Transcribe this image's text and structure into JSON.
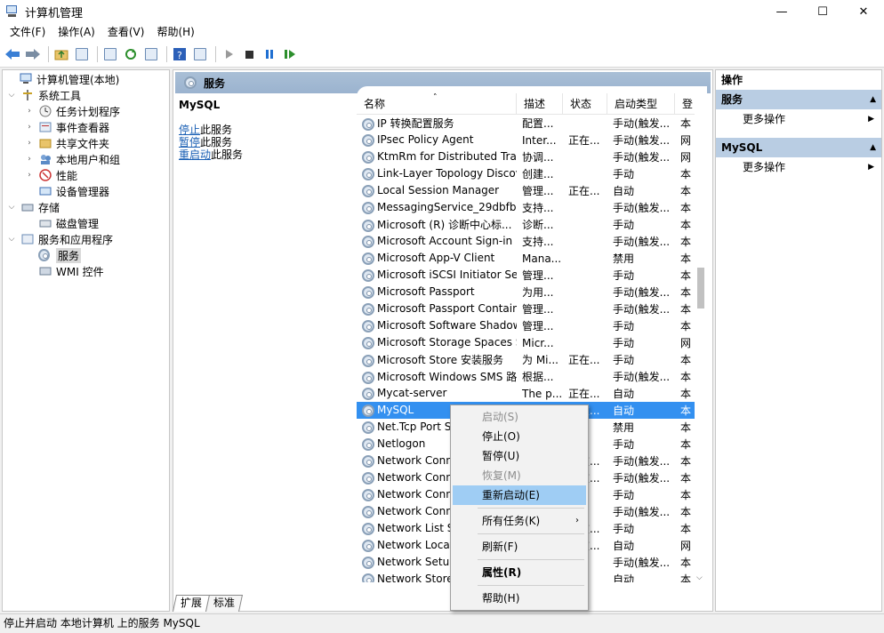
{
  "window": {
    "title": "计算机管理",
    "minimize": "—",
    "maximize": "☐",
    "close": "✕"
  },
  "menubar": [
    "文件(F)",
    "操作(A)",
    "查看(V)",
    "帮助(H)"
  ],
  "tree": {
    "root": "计算机管理(本地)",
    "system_tools": "系统工具",
    "task_scheduler": "任务计划程序",
    "event_viewer": "事件查看器",
    "shared_folders": "共享文件夹",
    "local_users": "本地用户和组",
    "performance": "性能",
    "device_manager": "设备管理器",
    "storage": "存储",
    "disk_management": "磁盘管理",
    "services_apps": "服务和应用程序",
    "services": "服务",
    "wmi": "WMI 控件"
  },
  "center": {
    "header": "服务",
    "selected_service": "MySQL",
    "stop_link": "停止",
    "stop_suffix": "此服务",
    "pause_link": "暂停",
    "pause_suffix": "此服务",
    "restart_link": "重启动",
    "restart_suffix": "此服务"
  },
  "table": {
    "columns": [
      "名称",
      "描述",
      "状态",
      "启动类型",
      "登"
    ],
    "rows": [
      [
        "IP 转换配置服务",
        "配置...",
        "",
        "手动(触发...",
        "本"
      ],
      [
        "IPsec Policy Agent",
        "Inter...",
        "正在...",
        "手动(触发...",
        "网"
      ],
      [
        "KtmRm for Distributed Tran...",
        "协调...",
        "",
        "手动(触发...",
        "网"
      ],
      [
        "Link-Layer Topology Discov...",
        "创建...",
        "",
        "手动",
        "本"
      ],
      [
        "Local Session Manager",
        "管理...",
        "正在...",
        "自动",
        "本"
      ],
      [
        "MessagingService_29dbfb1",
        "支持...",
        "",
        "手动(触发...",
        "本"
      ],
      [
        "Microsoft (R) 诊断中心标...",
        "诊断...",
        "",
        "手动",
        "本"
      ],
      [
        "Microsoft Account Sign-in ...",
        "支持...",
        "",
        "手动(触发...",
        "本"
      ],
      [
        "Microsoft App-V Client",
        "Mana...",
        "",
        "禁用",
        "本"
      ],
      [
        "Microsoft iSCSI Initiator Ser...",
        "管理...",
        "",
        "手动",
        "本"
      ],
      [
        "Microsoft Passport",
        "为用...",
        "",
        "手动(触发...",
        "本"
      ],
      [
        "Microsoft Passport Container",
        "管理...",
        "",
        "手动(触发...",
        "本"
      ],
      [
        "Microsoft Software Shadow...",
        "管理...",
        "",
        "手动",
        "本"
      ],
      [
        "Microsoft Storage Spaces S...",
        "Micr...",
        "",
        "手动",
        "网"
      ],
      [
        "Microsoft Store 安装服务",
        "为 Mi...",
        "正在...",
        "手动",
        "本"
      ],
      [
        "Microsoft Windows SMS 路...",
        "根据...",
        "",
        "手动(触发...",
        "本"
      ],
      [
        "Mycat-server",
        "The p...",
        "正在...",
        "自动",
        "本"
      ],
      [
        "MySQL",
        "",
        "正在...",
        "自动",
        "本"
      ],
      [
        "Net.Tcp Port S",
        "",
        "",
        "禁用",
        "本"
      ],
      [
        "Netlogon",
        "",
        "",
        "手动",
        "本"
      ],
      [
        "Network Conn",
        "",
        "正在...",
        "手动(触发...",
        "本"
      ],
      [
        "Network Conn",
        "",
        "正在...",
        "手动(触发...",
        "本"
      ],
      [
        "Network Conn",
        "",
        "",
        "手动",
        "本"
      ],
      [
        "Network Conn",
        "",
        "",
        "手动(触发...",
        "本"
      ],
      [
        "Network List S",
        "",
        "正在...",
        "手动",
        "本"
      ],
      [
        "Network Locat",
        "",
        "正在...",
        "自动",
        "网"
      ],
      [
        "Network Setup",
        "",
        "",
        "手动(触发...",
        "本"
      ],
      [
        "Network Store",
        "",
        "",
        "自动",
        "本"
      ]
    ]
  },
  "tabs": [
    "扩展",
    "标准"
  ],
  "actions": {
    "header": "操作",
    "section1": "服务",
    "section1_more": "更多操作",
    "section2": "MySQL",
    "section2_more": "更多操作"
  },
  "context_menu": [
    "启动(S)",
    "停止(O)",
    "暂停(U)",
    "恢复(M)",
    "重新启动(E)",
    "所有任务(K)",
    "刷新(F)",
    "属性(R)",
    "帮助(H)"
  ],
  "status": "停止并启动 本地计算机 上的服务 MySQL",
  "colors": {
    "selected_row": "#3390f0",
    "header_band": "#a9bfd6",
    "menu_hover": "#9fcdf4",
    "link": "#1a5fb4"
  }
}
